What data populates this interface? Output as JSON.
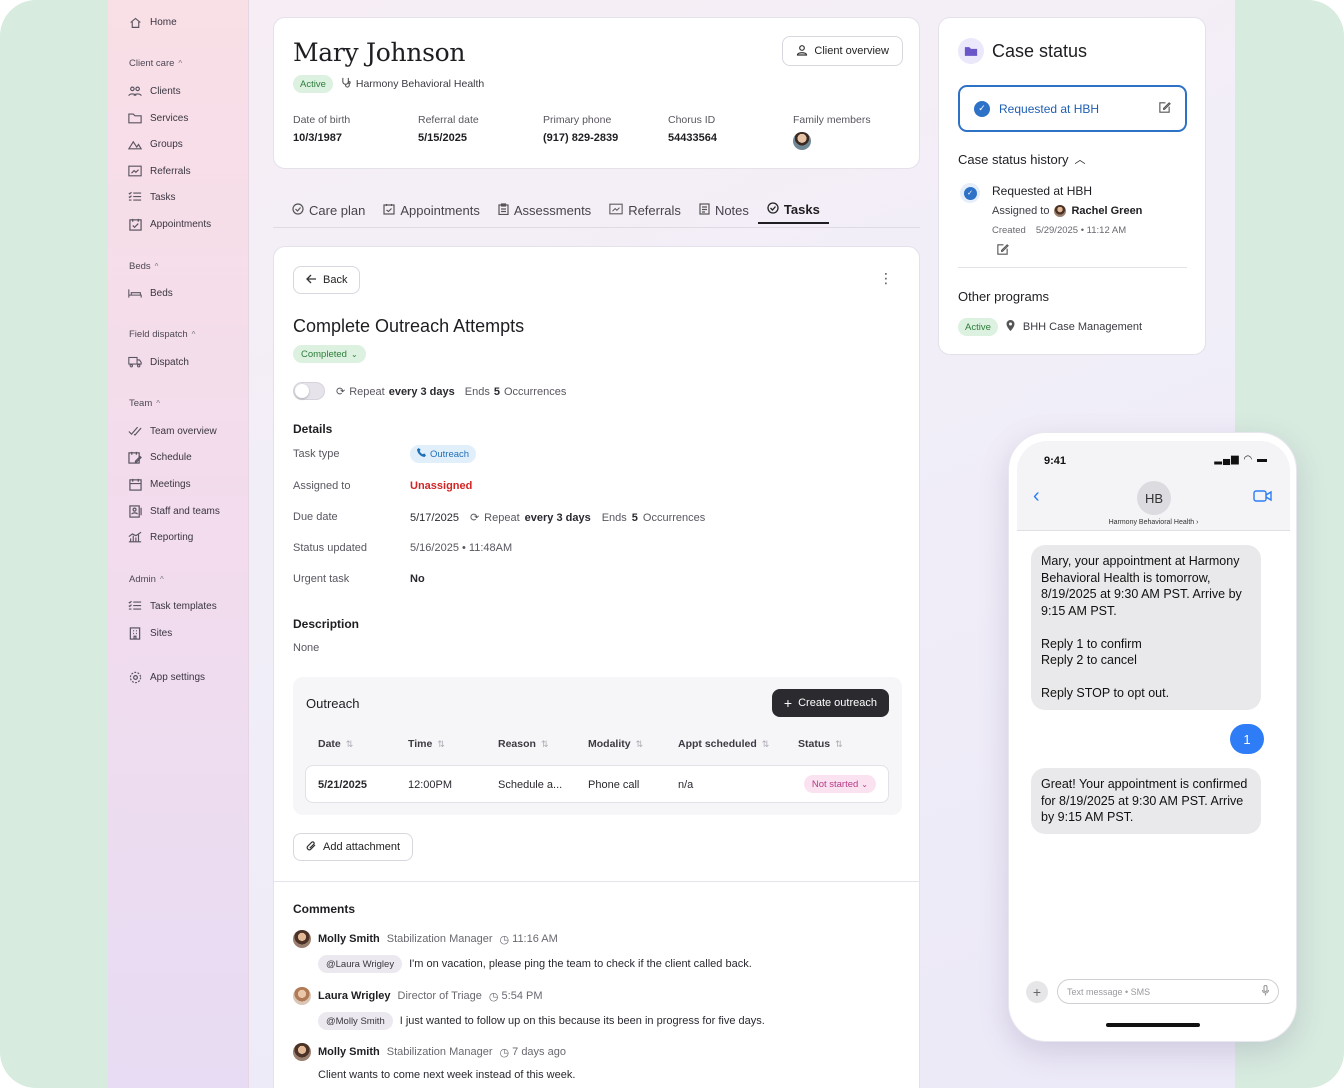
{
  "sidebar": {
    "home": "Home",
    "sections": [
      {
        "title": "Client care",
        "items": [
          "Clients",
          "Services",
          "Groups",
          "Referrals",
          "Tasks",
          "Appointments"
        ]
      },
      {
        "title": "Beds",
        "items": [
          "Beds"
        ]
      },
      {
        "title": "Field dispatch",
        "items": [
          "Dispatch"
        ]
      },
      {
        "title": "Team",
        "items": [
          "Team overview",
          "Schedule",
          "Meetings",
          "Staff and teams",
          "Reporting"
        ]
      },
      {
        "title": "Admin",
        "items": [
          "Task templates",
          "Sites"
        ]
      }
    ],
    "settings": "App settings"
  },
  "client": {
    "name": "Mary Johnson",
    "status": "Active",
    "org": "Harmony Behavioral Health",
    "overview_button": "Client overview",
    "fields": [
      {
        "label": "Date of birth",
        "value": "10/3/1987"
      },
      {
        "label": "Referral date",
        "value": "5/15/2025"
      },
      {
        "label": "Primary phone",
        "value": "(917) 829-2839"
      },
      {
        "label": "Chorus ID",
        "value": "54433564"
      },
      {
        "label": "Family members",
        "value": ""
      }
    ]
  },
  "tabs": [
    "Care plan",
    "Appointments",
    "Assessments",
    "Referrals",
    "Notes",
    "Tasks"
  ],
  "active_tab": "Tasks",
  "task": {
    "back": "Back",
    "title": "Complete Outreach Attempts",
    "status": "Completed",
    "repeat_label": "Repeat",
    "repeat_every": "every 3 days",
    "ends_label": "Ends",
    "ends_count": "5",
    "ends_unit": "Occurrences",
    "details_heading": "Details",
    "details": {
      "task_type_label": "Task type",
      "task_type": "Outreach",
      "assigned_label": "Assigned to",
      "assigned": "Unassigned",
      "due_label": "Due date",
      "due": "5/17/2025",
      "status_updated_label": "Status updated",
      "status_updated": "5/16/2025 • 11:48AM",
      "urgent_label": "Urgent task",
      "urgent": "No"
    },
    "description_heading": "Description",
    "description": "None",
    "outreach": {
      "title": "Outreach",
      "create_button": "Create outreach",
      "columns": [
        "Date",
        "Time",
        "Reason",
        "Modality",
        "Appt scheduled",
        "Status"
      ],
      "row": {
        "date": "5/21/2025",
        "time": "12:00PM",
        "reason": "Schedule a...",
        "modality": "Phone call",
        "appt": "n/a",
        "status": "Not started"
      }
    },
    "attach_button": "Add attachment",
    "comments_heading": "Comments",
    "comments": [
      {
        "name": "Molly Smith",
        "role": "Stabilization Manager",
        "time": "11:16 AM",
        "mention": "@Laura Wrigley",
        "text": "I'm on vacation, please ping the team to check if the client called back."
      },
      {
        "name": "Laura Wrigley",
        "role": "Director of Triage",
        "time": "5:54 PM",
        "mention": "@Molly Smith",
        "text": "I just wanted to follow up on this because its been in progress for five days."
      },
      {
        "name": "Molly Smith",
        "role": "Stabilization Manager",
        "time": "7 days ago",
        "mention": "",
        "text": "Client wants to come next week instead of this week."
      }
    ]
  },
  "case": {
    "title": "Case status",
    "current": "Requested at HBH",
    "history_heading": "Case status history",
    "history_title": "Requested at HBH",
    "assigned_label": "Assigned to",
    "assigned_to": "Rachel Green",
    "created_label": "Created",
    "created": "5/29/2025 • 11:12 AM",
    "other_heading": "Other programs",
    "other_status": "Active",
    "other_program": "BHH Case Management"
  },
  "phone": {
    "time": "9:41",
    "initials": "HB",
    "contact": "Harmony Behavioral Health ›",
    "msg1": "Mary, your appointment at Harmony Behavioral Health is tomorrow, 8/19/2025 at 9:30 AM PST. Arrive by 9:15 AM PST.\n\nReply 1 to confirm\nReply 2 to cancel\n\nReply STOP to opt out.",
    "reply": "1",
    "msg2": "Great! Your appointment is confirmed for 8/19/2025 at 9:30 AM PST. Arrive by 9:15 AM PST.",
    "input_placeholder": "Text message • SMS"
  },
  "colors": {
    "accent_blue": "#2e72c7",
    "active_green": "#2e7d3c",
    "unassigned_red": "#d32424",
    "imessage_blue": "#2e7cf6"
  }
}
